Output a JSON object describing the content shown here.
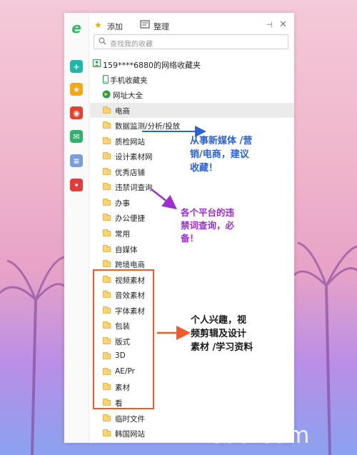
{
  "toolbar": {
    "add_label": "添加",
    "organize_label": "整理"
  },
  "search": {
    "placeholder": "查找我的收藏"
  },
  "tree": {
    "root": "159****6880的网络收藏夹",
    "items": [
      {
        "label": "手机收藏夹",
        "icon": "phone-icon"
      },
      {
        "label": "网址大全",
        "icon": "nav-site-icon"
      },
      {
        "label": "电商",
        "icon": "folder-icon",
        "selected": true
      },
      {
        "label": "数据监测/分析/投放",
        "icon": "folder-icon"
      },
      {
        "label": "质检网站",
        "icon": "folder-icon"
      },
      {
        "label": "设计素材网",
        "icon": "folder-icon"
      },
      {
        "label": "优秀店铺",
        "icon": "folder-icon"
      },
      {
        "label": "违禁词查询",
        "icon": "folder-icon"
      },
      {
        "label": "办事",
        "icon": "folder-icon"
      },
      {
        "label": "办公便捷",
        "icon": "folder-icon"
      },
      {
        "label": "常用",
        "icon": "folder-icon"
      },
      {
        "label": "自媒体",
        "icon": "folder-icon"
      },
      {
        "label": "跨境电商",
        "icon": "folder-icon"
      },
      {
        "label": "视频素材",
        "icon": "folder-icon"
      },
      {
        "label": "音效素材",
        "icon": "folder-icon"
      },
      {
        "label": "字体素材",
        "icon": "folder-icon"
      },
      {
        "label": "包装",
        "icon": "folder-icon"
      },
      {
        "label": "版式",
        "icon": "folder-icon"
      },
      {
        "label": "3D",
        "icon": "folder-icon"
      },
      {
        "label": "AE/Pr",
        "icon": "folder-icon"
      },
      {
        "label": "素材",
        "icon": "folder-icon"
      },
      {
        "label": "看",
        "icon": "folder-icon"
      },
      {
        "label": "临时文件",
        "icon": "folder-icon"
      },
      {
        "label": "韩国网站",
        "icon": "folder-icon"
      }
    ]
  },
  "sidebar": {
    "icons": [
      {
        "name": "browser-logo-icon",
        "glyph": "e",
        "color": "#2dbb5d"
      },
      {
        "name": "plus-app-icon",
        "glyph": "+",
        "color": "#20b7a8"
      },
      {
        "name": "favorites-star-icon",
        "glyph": "★",
        "color": "#f3a916"
      },
      {
        "name": "weibo-icon",
        "glyph": "◉",
        "color": "#e6402f"
      },
      {
        "name": "mail-icon",
        "glyph": "✉",
        "color": "#2fb36b"
      },
      {
        "name": "document-icon",
        "glyph": "≡",
        "color": "#7a9fd8"
      },
      {
        "name": "shopping-icon",
        "glyph": "•",
        "color": "#e33a3a"
      }
    ]
  },
  "annotations": {
    "note1": [
      "从事新媒体 /营",
      "销/电商，建议",
      "收藏！"
    ],
    "note2": [
      "各个平台的违",
      "禁词查询，必",
      "备！"
    ],
    "note3": [
      "个人兴趣，视",
      "频剪辑及设计",
      "素材 /学习资料"
    ]
  },
  "colors": {
    "note1": "#2a63d6",
    "note2": "#9b2fd3",
    "note3": "#1a1a1a",
    "highlight_box": "#f05a2a"
  },
  "watermark": "khcoo.com"
}
